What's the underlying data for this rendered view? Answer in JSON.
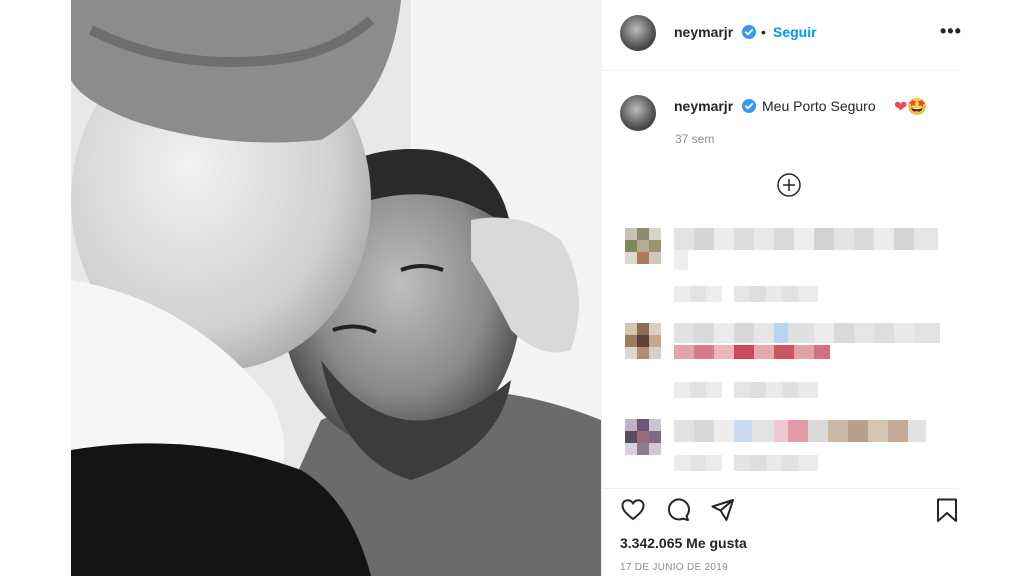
{
  "post": {
    "username": "neymarjr",
    "follow_label": "Seguir",
    "dot": "•",
    "more_label": "•••",
    "caption_text": "Meu Porto Seguro",
    "caption_emojis": "❤🤩",
    "caption_time": "37 sem",
    "likes": "3.342.065 Me gusta",
    "date": "17 DE JUNIO DE 2019"
  },
  "comments": [
    {
      "pixelated": true
    },
    {
      "pixelated": true
    },
    {
      "pixelated": true
    }
  ],
  "colors": {
    "link": "#0095f6",
    "verified": "#3897f0",
    "text": "#262626",
    "muted": "#8e8e8e",
    "heart": "#ed4956"
  }
}
